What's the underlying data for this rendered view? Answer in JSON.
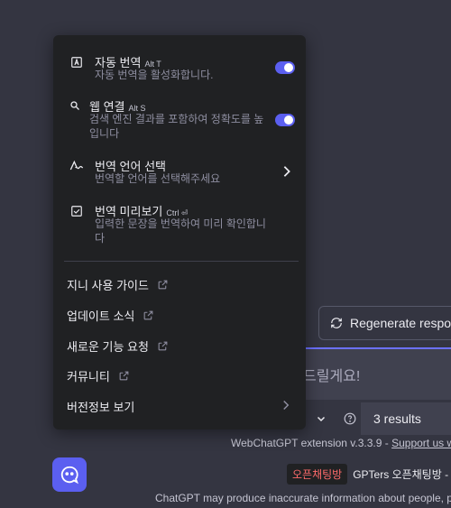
{
  "menu": {
    "items": [
      {
        "icon": "letter-a-box-icon",
        "title": "자동 번역",
        "shortcut": "Alt T",
        "desc": "자동 번역을 활성화합니다.",
        "control": "toggle",
        "state": "on"
      },
      {
        "icon": "search-icon",
        "title": "웹 연결",
        "shortcut": "Alt S",
        "desc": "검색 엔진 결과를 포함하여 정확도를 높입니다",
        "control": "toggle",
        "state": "on"
      },
      {
        "icon": "translate-wave-icon",
        "title": "번역 언어 선택",
        "shortcut": "",
        "desc": "번역할 언어를 선택해주세요",
        "control": "chevron"
      },
      {
        "icon": "checkbox-icon",
        "title": "번역 미리보기",
        "shortcut": "Ctrl ⏎",
        "desc": "입력한 문장을 번역하여 미리 확인합니다"
      }
    ],
    "links": [
      {
        "label": "지니 사용 가이드"
      },
      {
        "label": "업데이트 소식"
      },
      {
        "label": "새로운 기능 요청"
      },
      {
        "label": "커뮤니티"
      },
      {
        "label": "버전정보 보기"
      }
    ]
  },
  "background": {
    "regenerate_label": "Regenerate response",
    "input_placeholder_visible": "드릴게요!",
    "results_label": "3 results",
    "extension_text": "WebChatGPT extension v.3.3.9 - ",
    "extension_link": "Support us wi",
    "chat_tag": "오픈채팅방",
    "chat_text": "GPTers 오픈채팅방 -",
    "disclaimer": "ChatGPT may produce inaccurate information about people, p"
  },
  "colors": {
    "accent": "#5b5ff0",
    "menu_bg": "#202123",
    "page_bg": "#343541"
  }
}
